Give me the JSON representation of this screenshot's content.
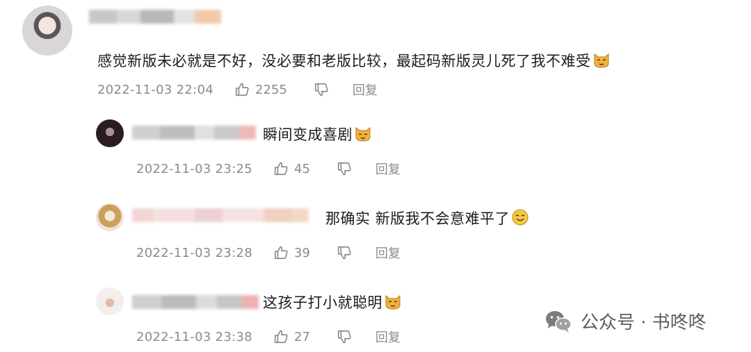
{
  "comments": [
    {
      "text": "感觉新版未必就是不好，没必要和老版比较，最起码新版灵儿死了我不难受",
      "timestamp": "2022-11-03 22:04",
      "likes": "2255",
      "reply_label": "回复",
      "emoji": "cat-face-emoji"
    },
    {
      "text": "瞬间变成喜剧",
      "timestamp": "2022-11-03 23:25",
      "likes": "45",
      "reply_label": "回复",
      "emoji": "cat-face-emoji"
    },
    {
      "text": "那确实 新版我不会意难平了",
      "timestamp": "2022-11-03 23:28",
      "likes": "39",
      "reply_label": "回复",
      "emoji": "smile-emoji"
    },
    {
      "text": "这孩子打小就聪明",
      "timestamp": "2022-11-03 23:38",
      "likes": "27",
      "reply_label": "回复",
      "emoji": "cat-face-emoji"
    }
  ],
  "watermark": {
    "text": "公众号 · 书咚咚",
    "icon": "wechat-icon"
  },
  "colors": {
    "text": "#1c1c1c",
    "meta": "#8a8a8a",
    "emoji": "#f2b33d"
  }
}
